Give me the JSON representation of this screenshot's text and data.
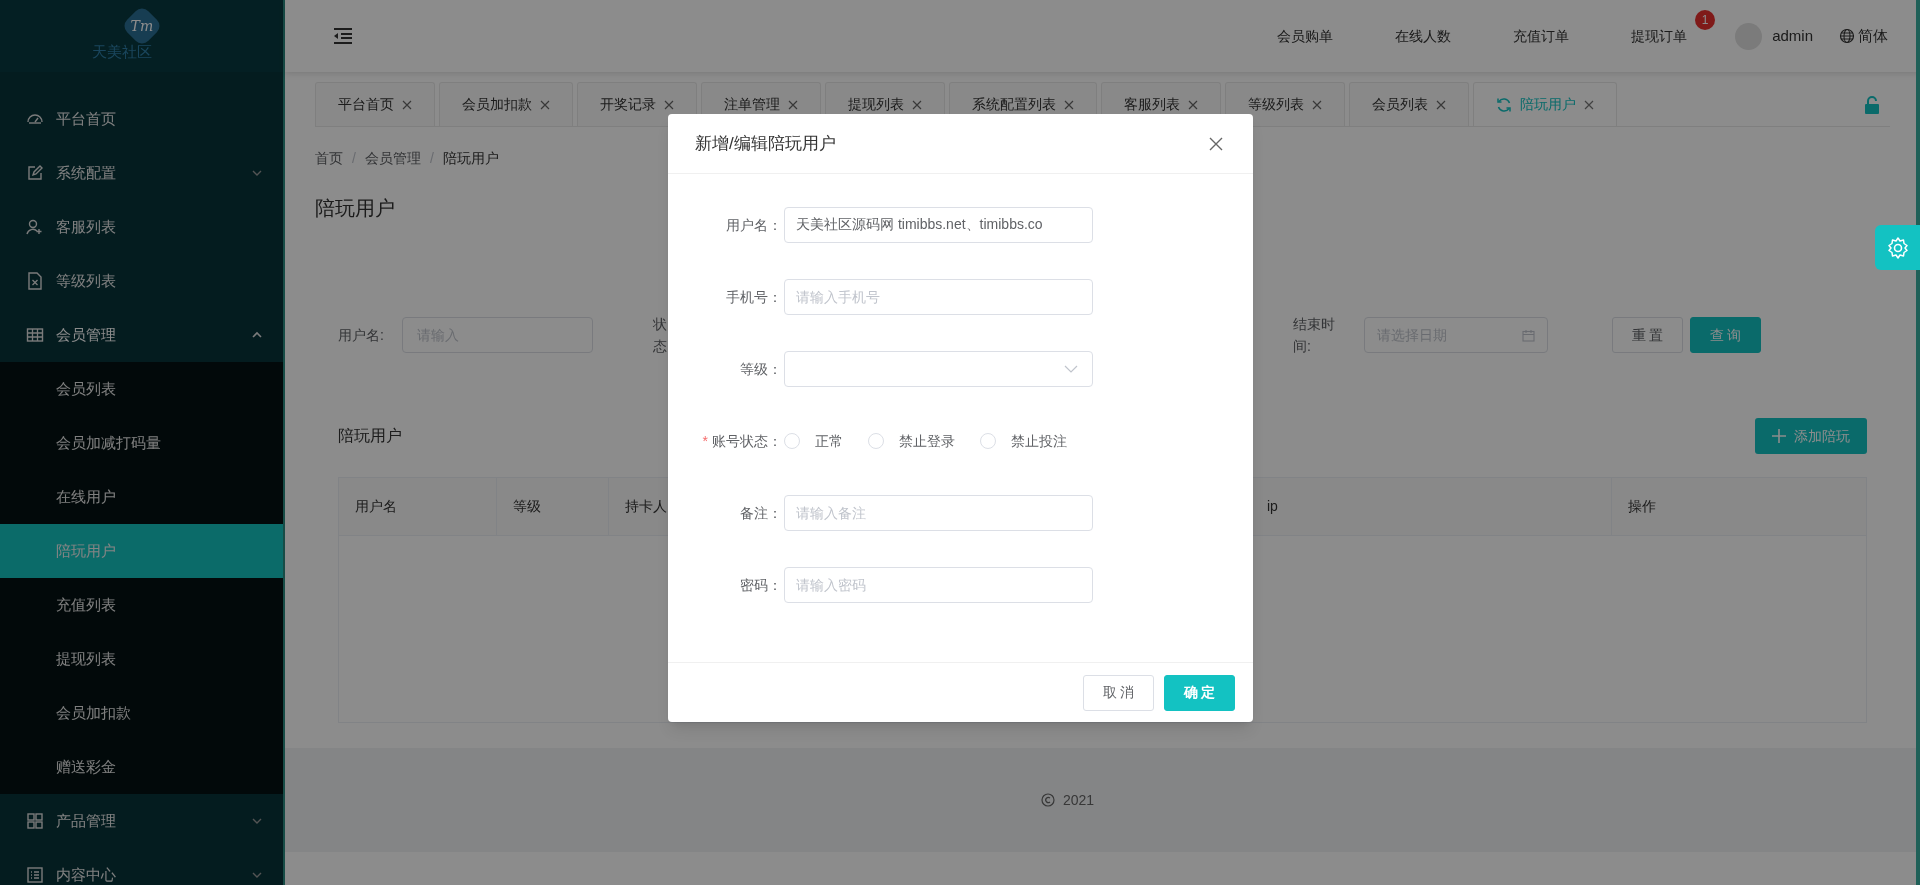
{
  "sidebar": {
    "logo_mark": "Tm",
    "logo_text": "天美社区",
    "items": [
      {
        "label": "平台首页",
        "selected": false
      },
      {
        "label": "系统配置",
        "selected": false,
        "expanded": false
      },
      {
        "label": "客服列表",
        "selected": false
      },
      {
        "label": "等级列表",
        "selected": false
      },
      {
        "label": "会员管理",
        "selected": false,
        "expanded": true,
        "children": [
          {
            "label": "会员列表",
            "selected": false
          },
          {
            "label": "会员加减打码量",
            "selected": false
          },
          {
            "label": "在线用户",
            "selected": false
          },
          {
            "label": "陪玩用户",
            "selected": true
          },
          {
            "label": "充值列表",
            "selected": false
          },
          {
            "label": "提现列表",
            "selected": false
          },
          {
            "label": "会员加扣款",
            "selected": false
          },
          {
            "label": "赠送彩金",
            "selected": false
          }
        ]
      },
      {
        "label": "产品管理",
        "selected": false,
        "expanded": false
      },
      {
        "label": "内容中心",
        "selected": false,
        "expanded": false
      }
    ]
  },
  "header": {
    "links": [
      {
        "label": "会员购单"
      },
      {
        "label": "在线人数"
      },
      {
        "label": "充值订单"
      },
      {
        "label": "提现订单",
        "badge": "1"
      }
    ],
    "user": "admin",
    "language": "简体"
  },
  "tabs": [
    {
      "label": "平台首页",
      "selected": false
    },
    {
      "label": "会员加扣款",
      "selected": false
    },
    {
      "label": "开奖记录",
      "selected": false
    },
    {
      "label": "注单管理",
      "selected": false
    },
    {
      "label": "提现列表",
      "selected": false
    },
    {
      "label": "系统配置列表",
      "selected": false
    },
    {
      "label": "客服列表",
      "selected": false
    },
    {
      "label": "等级列表",
      "selected": false
    },
    {
      "label": "会员列表",
      "selected": false
    },
    {
      "label": "陪玩用户",
      "selected": true
    }
  ],
  "breadcrumb": [
    "首页",
    "会员管理",
    "陪玩用户"
  ],
  "breadcrumb_separator": "/",
  "page_title": "陪玩用户",
  "filters": [
    {
      "kind": "text",
      "label": "用户名:",
      "placeholder": "请输入"
    },
    {
      "kind": "hidden",
      "label": "状态"
    },
    {
      "kind": "date",
      "label": "结束时间:",
      "placeholder": "请选择日期"
    }
  ],
  "filter_buttons": [
    {
      "label": "重 置",
      "kind": "default"
    },
    {
      "label": "查 询",
      "kind": "primary"
    }
  ],
  "section_title": "陪玩用户",
  "add_button": "添加陪玩",
  "table": {
    "columns": [
      "用户名",
      "等级",
      "持卡人",
      "ip",
      "操作"
    ]
  },
  "footer": {
    "year": "2021"
  },
  "dialog": {
    "title": "新增/编辑陪玩用户",
    "fields": [
      {
        "kind": "text",
        "label": "用户名：",
        "value": "天美社区源码网 timibbs.net、timibbs.co"
      },
      {
        "kind": "text",
        "label": "手机号：",
        "placeholder": "请输入手机号"
      },
      {
        "kind": "select",
        "label": "等级："
      },
      {
        "kind": "radio",
        "label": "账号状态：",
        "required_mark": "*",
        "options": [
          {
            "label": "正常",
            "selected": false
          },
          {
            "label": "禁止登录",
            "selected": false
          },
          {
            "label": "禁止投注",
            "selected": false
          }
        ]
      },
      {
        "kind": "text",
        "label": "备注：",
        "placeholder": "请输入备注"
      },
      {
        "kind": "text",
        "label": "密码：",
        "placeholder": "请输入密码"
      }
    ],
    "buttons": [
      {
        "label": "取 消",
        "kind": "default"
      },
      {
        "label": "确 定",
        "kind": "primary"
      }
    ]
  }
}
